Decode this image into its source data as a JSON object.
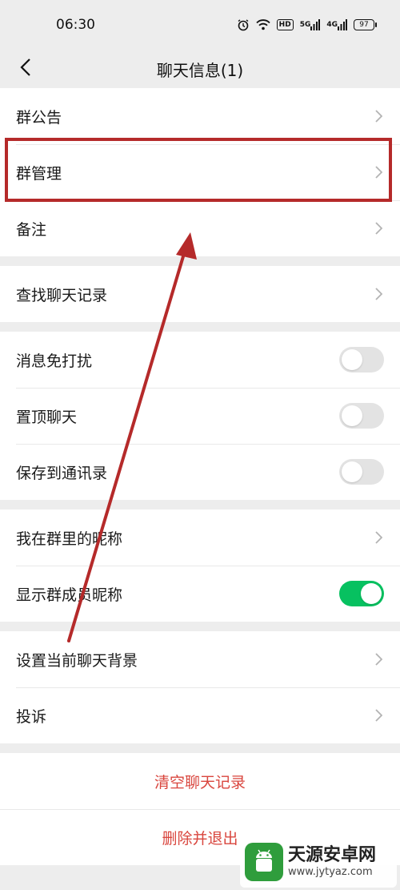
{
  "status_bar": {
    "time": "06:30",
    "hd_label": "HD",
    "signal_5g_label": "5G",
    "signal_4g_label": "4G",
    "battery_level": "97"
  },
  "nav": {
    "title": "聊天信息(1)",
    "back_icon": "chevron-left-icon"
  },
  "groups": [
    {
      "rows": [
        {
          "label": "群公告",
          "type": "link"
        },
        {
          "label": "群管理",
          "type": "link"
        },
        {
          "label": "备注",
          "type": "link"
        }
      ]
    },
    {
      "rows": [
        {
          "label": "查找聊天记录",
          "type": "link"
        }
      ]
    },
    {
      "rows": [
        {
          "label": "消息免打扰",
          "type": "toggle",
          "on": false
        },
        {
          "label": "置顶聊天",
          "type": "toggle",
          "on": false
        },
        {
          "label": "保存到通讯录",
          "type": "toggle",
          "on": false
        }
      ]
    },
    {
      "rows": [
        {
          "label": "我在群里的昵称",
          "type": "link"
        },
        {
          "label": "显示群成员昵称",
          "type": "toggle",
          "on": true
        }
      ]
    },
    {
      "rows": [
        {
          "label": "设置当前聊天背景",
          "type": "link"
        },
        {
          "label": "投诉",
          "type": "link"
        }
      ]
    }
  ],
  "actions": {
    "clear_history": "清空聊天记录",
    "delete_exit": "删除并退出"
  },
  "colors": {
    "toggle_on": "#07c160",
    "toggle_off": "#e3e3e3",
    "danger": "#d9463e",
    "annotation": "#b52a2a"
  },
  "watermark": {
    "title": "天源安卓网",
    "url": "www.jytyaz.com"
  }
}
